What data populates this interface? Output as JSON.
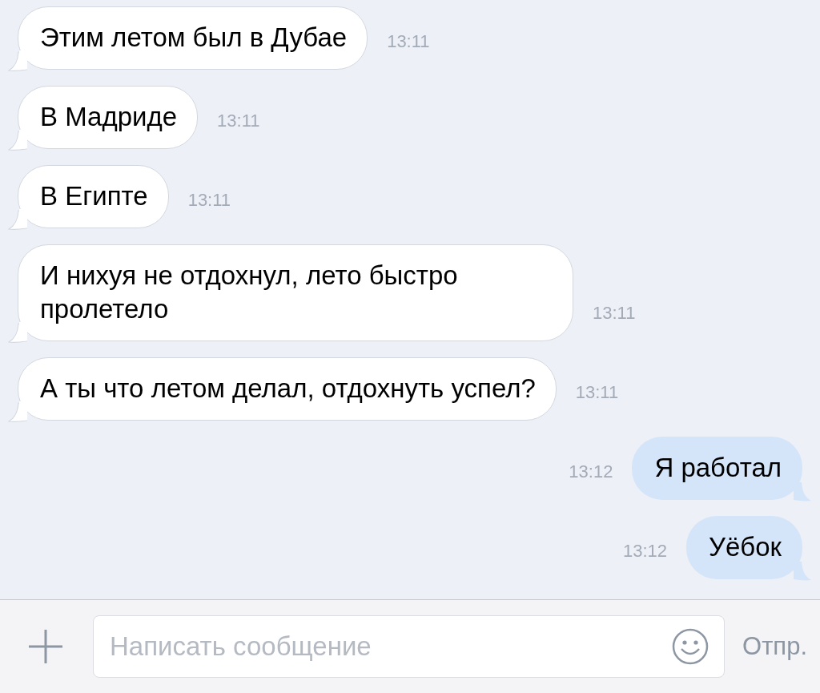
{
  "messages": [
    {
      "kind": "incoming",
      "text": "Этим летом был в Дубае",
      "time": "13:11"
    },
    {
      "kind": "incoming",
      "text": "В Мадриде",
      "time": "13:11"
    },
    {
      "kind": "incoming",
      "text": "В Египте",
      "time": "13:11"
    },
    {
      "kind": "incoming",
      "text": "И нихуя не отдохнул, лето быстро пролетело",
      "time": "13:11"
    },
    {
      "kind": "incoming",
      "text": "А ты что летом делал, отдохнуть успел?",
      "time": "13:11"
    },
    {
      "kind": "outgoing",
      "text": "Я работал",
      "time": "13:12"
    },
    {
      "kind": "outgoing",
      "text": "Уёбок",
      "time": "13:12"
    }
  ],
  "composer": {
    "placeholder": "Написать сообщение",
    "send": "Отпр."
  }
}
